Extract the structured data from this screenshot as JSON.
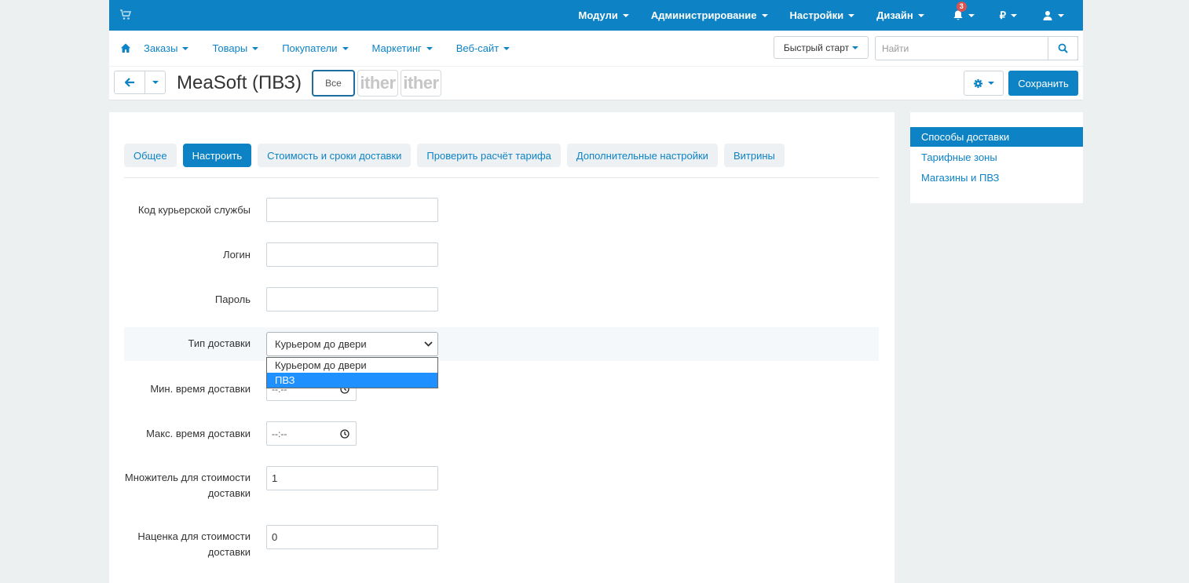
{
  "topbar": {
    "cart_icon": "cart-icon",
    "menu": [
      {
        "label": "Модули"
      },
      {
        "label": "Администрирование"
      },
      {
        "label": "Настройки"
      },
      {
        "label": "Дизайн"
      }
    ],
    "notifications_count": "3",
    "currency": "₽",
    "user_icon": "user-icon"
  },
  "nav": {
    "items": [
      {
        "label": "Заказы"
      },
      {
        "label": "Товары"
      },
      {
        "label": "Покупатели"
      },
      {
        "label": "Маркетинг"
      },
      {
        "label": "Веб-сайт"
      }
    ],
    "quick_start": "Быстрый старт",
    "search_placeholder": "Найти"
  },
  "header": {
    "title": "MeaSoft (ПВЗ)",
    "store_all": "Все",
    "store_logo_1": "ither",
    "store_logo_2": "ither",
    "save_label": "Сохранить"
  },
  "tabs": [
    {
      "label": "Общее",
      "active": false
    },
    {
      "label": "Настроить",
      "active": true
    },
    {
      "label": "Стоимость и сроки доставки",
      "active": false
    },
    {
      "label": "Проверить расчёт тарифа",
      "active": false
    },
    {
      "label": "Дополнительные настройки",
      "active": false
    },
    {
      "label": "Витрины",
      "active": false
    }
  ],
  "form": {
    "courier_code_label": "Код курьерской службы",
    "courier_code_value": "",
    "login_label": "Логин",
    "login_value": "",
    "password_label": "Пароль",
    "password_value": "",
    "delivery_type_label": "Тип доставки",
    "delivery_type_value": "Курьером до двери",
    "delivery_type_options": [
      "Курьером до двери",
      "ПВЗ"
    ],
    "delivery_type_highlighted": "ПВЗ",
    "min_time_label": "Мин. время доставки",
    "min_time_value": "--:--",
    "max_time_label": "Макс. время доставки",
    "max_time_value": "--:--",
    "multiplier_label_1": "Множитель для стоимости",
    "multiplier_label_2": "доставки",
    "multiplier_value": "1",
    "markup_label_1": "Наценка для стоимости",
    "markup_label_2": "доставки",
    "markup_value": "0"
  },
  "sidebar": {
    "items": [
      {
        "label": "Способы доставки",
        "active": true
      },
      {
        "label": "Тарифные зоны",
        "active": false
      },
      {
        "label": "Магазины и ПВЗ",
        "active": false
      }
    ]
  },
  "colors": {
    "accent": "#0d83c6",
    "badge": "#d9534f",
    "option_highlight": "#1e90ff"
  }
}
